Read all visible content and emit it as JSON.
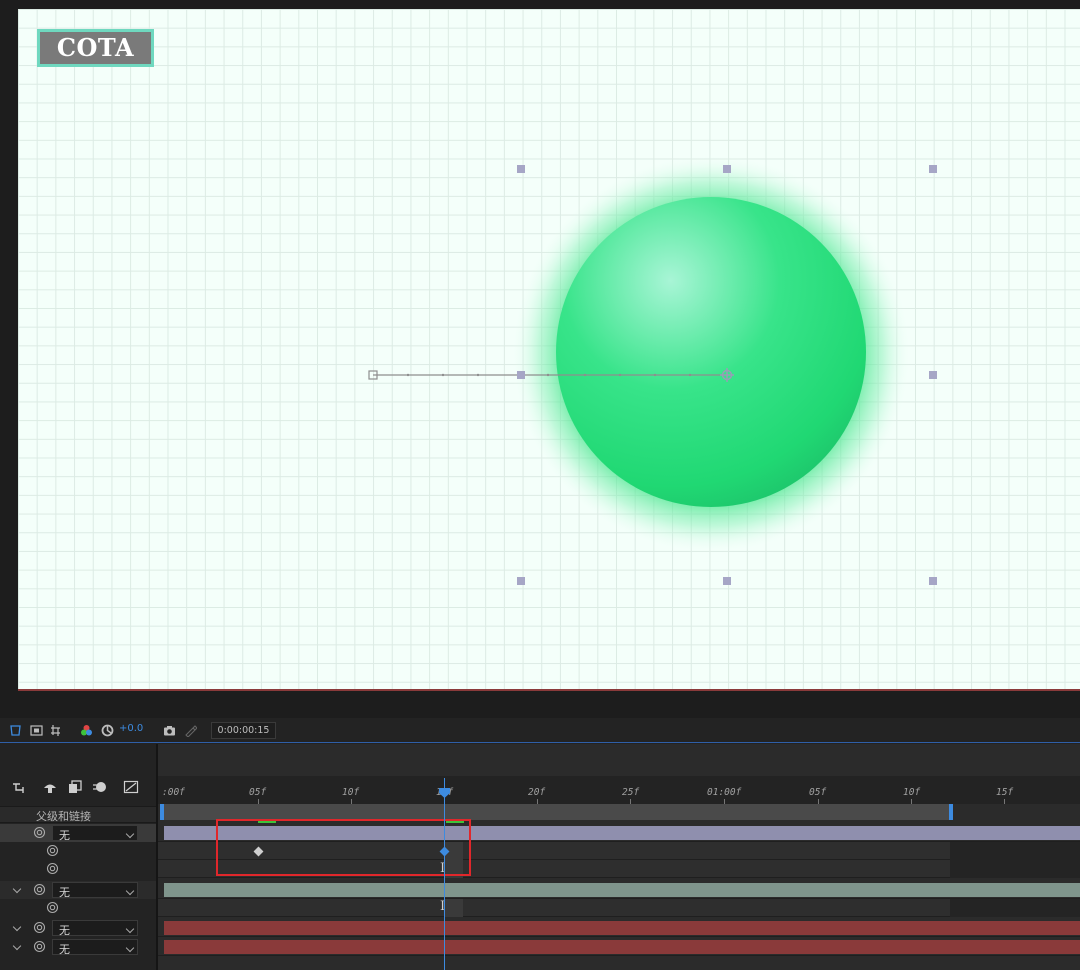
{
  "viewer": {
    "logo_text": "COTA",
    "canvas_bg": "#f4fffa",
    "sphere_color": "#2ee27f"
  },
  "viewer_toolbar": {
    "exposure": "+0.0",
    "timecode": "0:00:00:15"
  },
  "timeline": {
    "column_header": "父级和链接",
    "ruler_ticks": [
      ":00f",
      "05f",
      "10f",
      "15f",
      "20f",
      "25f",
      "01:00f",
      "05f",
      "10f",
      "15f"
    ],
    "layers": [
      {
        "parent": "无",
        "bar_color": "#8f8fae"
      },
      {
        "parent": "无",
        "bar_color": "#7f958c"
      },
      {
        "parent": "无",
        "bar_color": "#8a3a3a"
      },
      {
        "parent": "无",
        "bar_color": "#8a3a3a"
      }
    ],
    "accent_color": "#3d8be0",
    "highlight_color": "#e0272b"
  }
}
